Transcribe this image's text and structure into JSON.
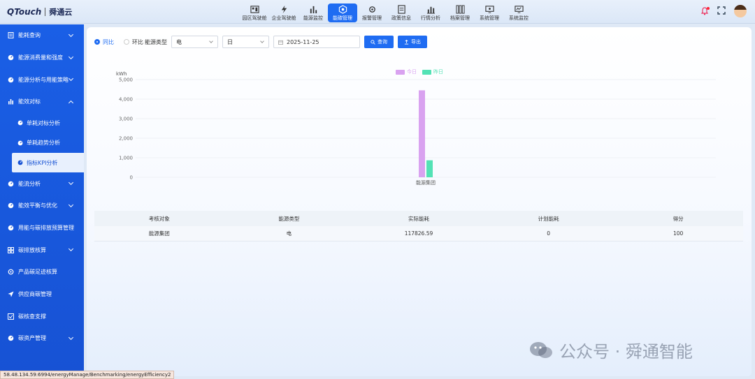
{
  "app": {
    "logo_q": "QTouch",
    "logo_cn": "舜通云"
  },
  "nav": [
    {
      "label": "园区驾驶舱",
      "icon": "dashboard-icon"
    },
    {
      "label": "企业驾驶舱",
      "icon": "lightning-icon"
    },
    {
      "label": "能源监控",
      "icon": "bar-chart-icon"
    },
    {
      "label": "能碳管理",
      "icon": "carbon-icon",
      "active": true
    },
    {
      "label": "报警管理",
      "icon": "alarm-gear-icon"
    },
    {
      "label": "政策信息",
      "icon": "document-icon"
    },
    {
      "label": "行情分析",
      "icon": "analysis-chart-icon"
    },
    {
      "label": "档案管理",
      "icon": "archive-icon"
    },
    {
      "label": "系统管理",
      "icon": "monitor-icon"
    },
    {
      "label": "系统监控",
      "icon": "system-monitor-icon"
    }
  ],
  "sidebar": {
    "items": [
      {
        "label": "能耗查询",
        "expanded": false
      },
      {
        "label": "能源消费量和强度",
        "expanded": false
      },
      {
        "label": "能源分析与用能策略",
        "expanded": false
      },
      {
        "label": "能效对标",
        "expanded": true
      }
    ],
    "sub_items": [
      {
        "label": "单耗对标分析"
      },
      {
        "label": "单耗趋势分析"
      },
      {
        "label": "指标KPI分析",
        "active": true
      }
    ],
    "items_after": [
      {
        "label": "能流分析"
      },
      {
        "label": "能效平衡与优化"
      },
      {
        "label": "用能与碳排放预算管理"
      },
      {
        "label": "碳排放核算"
      },
      {
        "label": "产品碳足迹核算"
      },
      {
        "label": "供应商碳管理"
      },
      {
        "label": "碳核查支撑"
      },
      {
        "label": "碳资产管理"
      }
    ]
  },
  "filters": {
    "radio_yoy": "同比",
    "radio_mom": "环比",
    "energy_type_label": "能源类型",
    "energy_type_value": "电",
    "period_value": "日",
    "date_value": "2025-11-25",
    "query_label": "查询",
    "export_label": "导出"
  },
  "chart_data": {
    "type": "bar",
    "ylabel": "kWh",
    "ylim": [
      0,
      5000
    ],
    "yticks": [
      "0",
      "1,000",
      "2,000",
      "3,000",
      "4,000",
      "5,000"
    ],
    "categories": [
      "能源集团"
    ],
    "series": [
      {
        "name": "今日",
        "values": [
          4450
        ],
        "color": "#d9a2f0"
      },
      {
        "name": "昨日",
        "values": [
          870
        ],
        "color": "#53e2b5"
      }
    ],
    "legend": "top"
  },
  "table": {
    "headers": [
      "考核对象",
      "能源类型",
      "实际能耗",
      "计划能耗",
      "得分"
    ],
    "rows": [
      [
        "能源集团",
        "电",
        "117826.59",
        "0",
        "100"
      ]
    ]
  },
  "status_url": "58.48.134.59:6994/energyManage/Benchmarking/energyEfficiency2",
  "watermark": "公众号 · 舜通智能"
}
